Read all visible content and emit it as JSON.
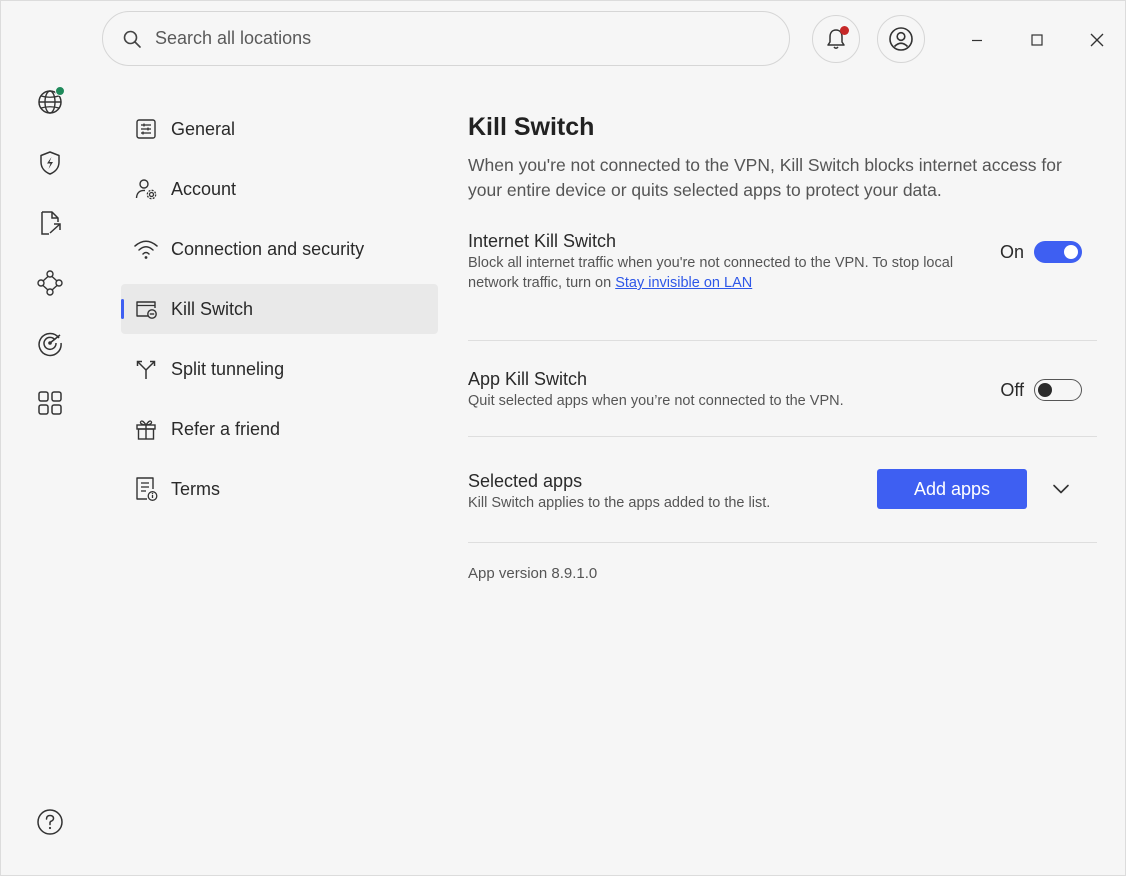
{
  "search": {
    "placeholder": "Search all locations"
  },
  "nav": {
    "items": [
      {
        "label": "General"
      },
      {
        "label": "Account"
      },
      {
        "label": "Connection and security"
      },
      {
        "label": "Kill Switch"
      },
      {
        "label": "Split tunneling"
      },
      {
        "label": "Refer a friend"
      },
      {
        "label": "Terms"
      }
    ],
    "active_index": 3
  },
  "page": {
    "title": "Kill Switch",
    "subtitle": "When you're not connected to the VPN, Kill Switch blocks internet access for your entire device or quits selected apps to protect your data."
  },
  "internet_kill_switch": {
    "title": "Internet Kill Switch",
    "desc_prefix": "Block all internet traffic when you're not connected to the VPN. To stop local network traffic, turn on ",
    "link": "Stay invisible on LAN",
    "state_label": "On",
    "enabled": true
  },
  "app_kill_switch": {
    "title": "App Kill Switch",
    "desc": "Quit selected apps when you’re not connected to the VPN.",
    "state_label": "Off",
    "enabled": false
  },
  "selected_apps": {
    "title": "Selected apps",
    "desc": "Kill Switch applies to the apps added to the list.",
    "button": "Add apps"
  },
  "version": "App version 8.9.1.0",
  "colors": {
    "accent": "#3e5ff2",
    "notification": "#c62828",
    "status_connected": "#1f8a5b"
  },
  "icons": {
    "rail": [
      "globe-icon",
      "shield-bolt-icon",
      "file-share-icon",
      "mesh-network-icon",
      "target-icon",
      "apps-grid-icon",
      "help-icon"
    ],
    "top": [
      "search-icon",
      "bell-icon",
      "user-icon",
      "minimize-icon",
      "maximize-icon",
      "close-icon"
    ]
  }
}
